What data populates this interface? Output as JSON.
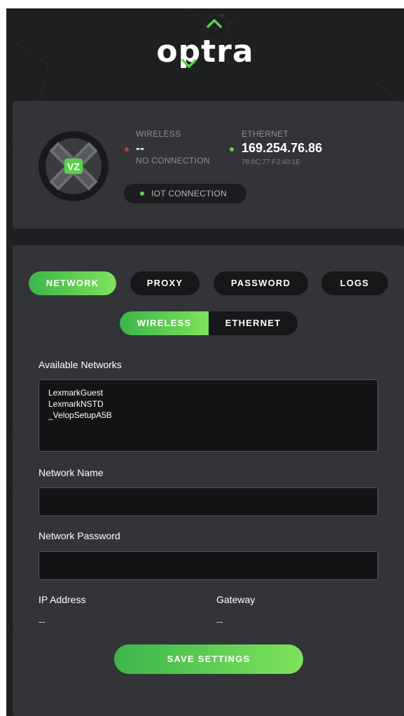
{
  "brand": {
    "logo_text": "optra",
    "accent": "#5ad14b"
  },
  "status": {
    "device_badge": "VZ",
    "wireless": {
      "title": "WIRELESS",
      "value": "--",
      "state": "NO CONNECTION",
      "indicator": "#c23b35"
    },
    "ethernet": {
      "title": "ETHERNET",
      "value": "169.254.76.86",
      "mac": "78:8C:77:F2:40:1E",
      "indicator": "#5ad14b"
    },
    "iot": {
      "label": "IOT CONNECTION",
      "indicator": "#5ad14b"
    }
  },
  "tabs": [
    {
      "label": "NETWORK",
      "active": true
    },
    {
      "label": "PROXY",
      "active": false
    },
    {
      "label": "PASSWORD",
      "active": false
    },
    {
      "label": "LOGS",
      "active": false
    }
  ],
  "connection_type": {
    "options": [
      {
        "label": "WIRELESS",
        "active": true
      },
      {
        "label": "ETHERNET",
        "active": false
      }
    ]
  },
  "form": {
    "available_networks_label": "Available Networks",
    "networks": [
      "LexmarkGuest",
      "LexmarkNSTD",
      "_VelopSetupA5B"
    ],
    "network_name_label": "Network Name",
    "network_name_value": "",
    "network_password_label": "Network Password",
    "network_password_value": "",
    "ip_label": "IP Address",
    "ip_value": "--",
    "gateway_label": "Gateway",
    "gateway_value": "--",
    "save_label": "SAVE SETTINGS"
  }
}
